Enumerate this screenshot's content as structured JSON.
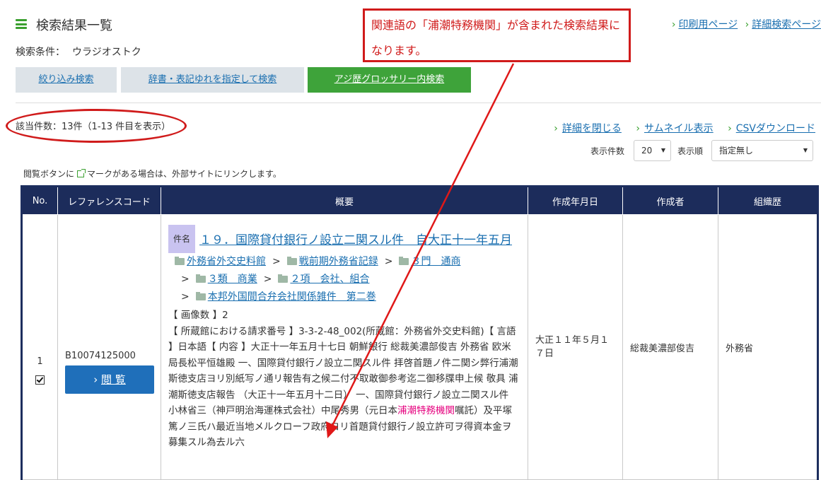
{
  "header": {
    "title": "検索結果一覧",
    "condition_label": "検索条件：",
    "condition_value": "ウラジオストク",
    "links": [
      "印刷用ページ",
      "詳細検索ページ"
    ]
  },
  "tabs": [
    {
      "label": "絞り込み検索"
    },
    {
      "label": "辞書・表記ゆれを指定して検索"
    },
    {
      "label": "アジ歴グロッサリー内検索"
    }
  ],
  "results": {
    "count_text": "該当件数：13件（1-13 件目を表示）",
    "actions": [
      "詳細を閉じる",
      "サムネイル表示",
      "CSVダウンロード"
    ],
    "per_page_label": "表示件数",
    "per_page_value": "20",
    "order_label": "表示順",
    "order_value": "指定無し",
    "note_before": "閲覧ボタンに",
    "note_after": "マークがある場合は、外部サイトにリンクします。"
  },
  "table": {
    "headers": [
      "No.",
      "レファレンスコード",
      "概要",
      "作成年月日",
      "作成者",
      "組織歴"
    ],
    "row": {
      "no": "1",
      "refcode": "B10074125000",
      "view_button": "閲 覧",
      "badge": "件名",
      "title": "１９．国際貸付銀行ノ設立二関スル件　自大正十一年五月",
      "breadcrumb": [
        "外務省外交史料館",
        "戦前期外務省記録",
        "３門　通商",
        "３類　商業",
        "２項　会社、組合",
        "本邦外国間合弁会社関係雑件　第二巻"
      ],
      "body_pre": "【 画像数 】2\n【 所蔵館における請求番号 】3-3-2-48_002(所蔵館：外務省外交史料館)【 言語 】日本語【 内容 】大正十一年五月十七日 朝鮮銀行 総裁美濃部俊吉 外務省 欧米局長松平恒雄殿 一、国際貸付銀行ノ設立二関スル件 拝啓首題ノ件二関シ弊行浦潮斯徳支店ヨリ別紙写ノ通リ報告有之候二付不取敢御参考迄二御移牒申上候 敬具 浦潮斯徳支店報告 （大正十一年五月十二日） 一、国際貸付銀行ノ設立二関スル件 小林省三（神戸明治海運株式会社）中尾秀男（元日本",
      "body_highlight": "浦潮特務機関",
      "body_post": "嘱託）及平塚篤ノ三氏ハ最近当地メルクローフ政府ヨリ首題貸付銀行ノ設立許可ヲ得資本金ヲ募集スル為去ル六",
      "date": "大正１１年５月１７日",
      "creator": "総裁美濃部俊吉",
      "org": "外務省"
    }
  },
  "annotation": {
    "text": "関連語の「浦潮特務機関」が含まれた検索結果になります。",
    "color": "#d01b1b"
  }
}
